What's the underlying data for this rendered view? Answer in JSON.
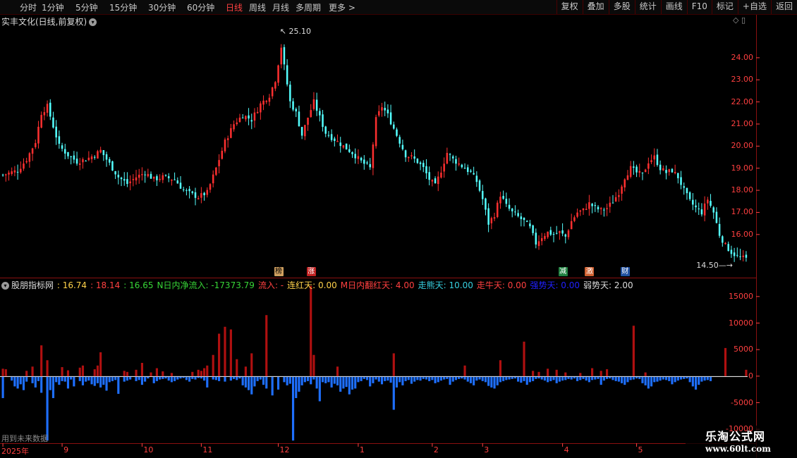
{
  "periods": [
    {
      "label": "分时"
    },
    {
      "label": "1分钟"
    },
    {
      "label": "5分钟"
    },
    {
      "label": "15分钟"
    },
    {
      "label": "30分钟"
    },
    {
      "label": "60分钟"
    },
    {
      "label": "日线",
      "active": true
    },
    {
      "label": "周线"
    },
    {
      "label": "月线"
    },
    {
      "label": "多周期"
    },
    {
      "label": "更多 >"
    }
  ],
  "tools": [
    "复权",
    "叠加",
    "多股",
    "统计",
    "画线",
    "F10",
    "标记",
    "+自选",
    "返回"
  ],
  "header": {
    "title": "实丰文化(日线,前复权)"
  },
  "top_icons": "◇ ▯",
  "indicator": {
    "name": "股朋指标网",
    "items": [
      {
        "text": ": 16.74",
        "color": "#ffd24a"
      },
      {
        "text": ": 18.14",
        "color": "#ff4040"
      },
      {
        "text": ": 16.65",
        "color": "#37d637"
      },
      {
        "text": "N日内净流入: -17373.79",
        "color": "#37d637"
      },
      {
        "text": "流入: -",
        "color": "#ff4040"
      },
      {
        "text": "连红天: 0.00",
        "color": "#ffd24a"
      },
      {
        "text": "M日内翻红天: 4.00",
        "color": "#ff4040"
      },
      {
        "text": "走熊天: 10.00",
        "color": "#37d0e0"
      },
      {
        "text": "走牛天: 0.00",
        "color": "#ff4040"
      },
      {
        "text": "强势天: 0.00",
        "color": "#2020ff"
      },
      {
        "text": "弱势天: 2.00",
        "color": "#dcdcdc"
      }
    ]
  },
  "future_note": "用到未来数据",
  "markers": [
    {
      "label": "榜",
      "day": 93,
      "color": "#d0a060",
      "text_color": "#000"
    },
    {
      "label": "涨",
      "day": 104,
      "color": "#c02020",
      "text_color": "#fff"
    },
    {
      "label": "减",
      "day": 189,
      "color": "#208040",
      "text_color": "#fff"
    },
    {
      "label": "激",
      "day": 198,
      "color": "#d06030",
      "text_color": "#fff"
    },
    {
      "label": "财",
      "day": 210,
      "color": "#2050a0",
      "text_color": "#fff"
    }
  ],
  "annotations": {
    "high": "25.10",
    "low": "14.50"
  },
  "watermark": {
    "line1": "乐淘公式网",
    "line2": "www.60lt.com"
  },
  "chart_data": {
    "type": "candlestick",
    "days": 252,
    "price_axis": {
      "ticks": [
        16,
        17,
        18,
        19,
        20,
        21,
        22,
        23,
        24
      ],
      "labels": [
        "16.00",
        "17.00",
        "18.00",
        "19.00",
        "20.00",
        "21.00",
        "22.00",
        "23.00",
        "24.00"
      ],
      "min": 14.4,
      "max": 25.4
    },
    "flow_axis": {
      "ticks": [
        15000,
        10000,
        5000,
        0,
        -5000,
        -10000
      ],
      "labels": [
        "15000",
        "10000",
        "5000",
        "0",
        "-5000",
        "-10000"
      ],
      "min": -12500,
      "max": 17500
    },
    "date_labels": [
      {
        "text": "2025年",
        "day": 0
      },
      {
        "text": "9",
        "day": 20
      },
      {
        "text": "10",
        "day": 47
      },
      {
        "text": "11",
        "day": 67
      },
      {
        "text": "12",
        "day": 93
      },
      {
        "text": "1",
        "day": 120
      },
      {
        "text": "2",
        "day": 145
      },
      {
        "text": "3",
        "day": 162
      },
      {
        "text": "4",
        "day": 189
      },
      {
        "text": "5",
        "day": 214
      }
    ],
    "price_anchors": [
      [
        0,
        18.7
      ],
      [
        5,
        18.9
      ],
      [
        8,
        19.4
      ],
      [
        11,
        20.2
      ],
      [
        13,
        21.5
      ],
      [
        15,
        21.8
      ],
      [
        17,
        20.9
      ],
      [
        19,
        20.0
      ],
      [
        22,
        19.6
      ],
      [
        25,
        19.3
      ],
      [
        28,
        19.4
      ],
      [
        31,
        19.6
      ],
      [
        33,
        19.8
      ],
      [
        36,
        19.2
      ],
      [
        39,
        18.6
      ],
      [
        42,
        18.3
      ],
      [
        45,
        18.6
      ],
      [
        48,
        18.8
      ],
      [
        51,
        18.5
      ],
      [
        54,
        18.6
      ],
      [
        58,
        18.5
      ],
      [
        61,
        18.0
      ],
      [
        64,
        17.8
      ],
      [
        66,
        17.7
      ],
      [
        69,
        17.9
      ],
      [
        72,
        19.0
      ],
      [
        75,
        20.2
      ],
      [
        78,
        21.0
      ],
      [
        81,
        21.4
      ],
      [
        84,
        21.2
      ],
      [
        87,
        21.9
      ],
      [
        90,
        22.3
      ],
      [
        92,
        23.0
      ],
      [
        94,
        24.5
      ],
      [
        95,
        23.6
      ],
      [
        97,
        22.0
      ],
      [
        99,
        21.5
      ],
      [
        101,
        20.5
      ],
      [
        103,
        21.3
      ],
      [
        105,
        22.0
      ],
      [
        107,
        21.3
      ],
      [
        109,
        20.6
      ],
      [
        112,
        20.3
      ],
      [
        115,
        20.0
      ],
      [
        118,
        19.7
      ],
      [
        121,
        19.3
      ],
      [
        124,
        19.0
      ],
      [
        126,
        21.2
      ],
      [
        128,
        21.8
      ],
      [
        130,
        21.4
      ],
      [
        132,
        20.8
      ],
      [
        134,
        20.2
      ],
      [
        136,
        19.6
      ],
      [
        138,
        19.5
      ],
      [
        140,
        19.3
      ],
      [
        142,
        19.0
      ],
      [
        144,
        18.5
      ],
      [
        146,
        18.2
      ],
      [
        148,
        18.9
      ],
      [
        150,
        19.7
      ],
      [
        152,
        19.4
      ],
      [
        154,
        19.2
      ],
      [
        156,
        19.0
      ],
      [
        158,
        18.8
      ],
      [
        160,
        18.4
      ],
      [
        162,
        17.6
      ],
      [
        164,
        16.5
      ],
      [
        166,
        16.9
      ],
      [
        168,
        17.8
      ],
      [
        170,
        17.3
      ],
      [
        172,
        17.0
      ],
      [
        174,
        16.8
      ],
      [
        176,
        16.6
      ],
      [
        178,
        16.3
      ],
      [
        180,
        15.6
      ],
      [
        182,
        15.9
      ],
      [
        184,
        16.1
      ],
      [
        186,
        16.0
      ],
      [
        188,
        16.1
      ],
      [
        190,
        15.9
      ],
      [
        192,
        16.6
      ],
      [
        194,
        17.0
      ],
      [
        196,
        17.1
      ],
      [
        198,
        17.4
      ],
      [
        200,
        17.2
      ],
      [
        202,
        17.1
      ],
      [
        204,
        17.2
      ],
      [
        206,
        17.5
      ],
      [
        208,
        17.9
      ],
      [
        210,
        18.6
      ],
      [
        212,
        19.0
      ],
      [
        214,
        18.8
      ],
      [
        216,
        18.7
      ],
      [
        218,
        19.3
      ],
      [
        220,
        19.5
      ],
      [
        222,
        19.0
      ],
      [
        224,
        18.8
      ],
      [
        226,
        18.9
      ],
      [
        228,
        18.6
      ],
      [
        230,
        18.0
      ],
      [
        232,
        17.5
      ],
      [
        234,
        17.2
      ],
      [
        236,
        17.0
      ],
      [
        238,
        17.6
      ],
      [
        240,
        17.0
      ],
      [
        242,
        16.0
      ],
      [
        244,
        15.5
      ],
      [
        246,
        15.2
      ],
      [
        248,
        15.0
      ],
      [
        251,
        14.9
      ]
    ],
    "flow_values": [
      -4000,
      600,
      900,
      -700,
      -1800,
      -2200,
      -1400,
      -2500,
      -900,
      3000,
      -1200,
      -2000,
      -800,
      -3000,
      1500,
      -12000,
      -2500,
      -4000,
      -1000,
      -1500,
      -800,
      -900,
      -2200,
      -500,
      -1800,
      700,
      -800,
      -1600,
      -900,
      -700,
      -1400,
      -1700,
      -1200,
      -2000,
      -1500,
      -2600,
      -1000,
      -800,
      -600,
      -3200,
      1200,
      -900,
      -700,
      -500,
      1000,
      -800,
      -600,
      -1500,
      -900,
      -300,
      600,
      -1200,
      -800,
      -500,
      -400,
      -300,
      -700,
      -1000,
      -800,
      -500,
      -300,
      -200,
      -600,
      -900,
      -400,
      -500,
      -200,
      -300,
      -700,
      -2000,
      3500,
      -500,
      -600,
      -800,
      6000,
      -900,
      9500,
      -700,
      -400,
      -600,
      -300,
      -1600,
      -2000,
      -2500,
      -3300,
      -1800,
      -800,
      -500,
      -1500,
      -2200,
      1200,
      -3500,
      3000,
      -2400,
      1500,
      -1000,
      -1600,
      -1300,
      -12000,
      -4000,
      -2800,
      -1600,
      -1000,
      -800,
      -1400,
      -500,
      -2200,
      -4600,
      -1000,
      -1200,
      -1000,
      -2000,
      -1300,
      -1600,
      -2800,
      -2200,
      -1900,
      -3300,
      -2400,
      -2200,
      -1000,
      -800,
      -400,
      -600,
      -1800,
      -1200,
      -500,
      -900,
      -1400,
      -800,
      -700,
      -1100,
      -6200,
      -2000,
      -1000,
      -1600,
      -800,
      -600,
      -1300,
      -900,
      -600,
      -700,
      -400,
      -500,
      -800,
      -600,
      -1200,
      -1000,
      -700,
      -500,
      -400,
      -1500,
      -900,
      -600,
      -400,
      -300,
      -500,
      -900,
      -1200,
      -1600,
      -700,
      -500,
      -800,
      -1000,
      -1700,
      -2000,
      -2200,
      -1600,
      -1000,
      -800,
      -600,
      -500,
      -400,
      -300,
      -900,
      -1100,
      -800,
      -1500,
      -1000,
      -800,
      -400,
      -300,
      -500,
      -700,
      -1000,
      -800,
      -600,
      -1200,
      -900,
      -700,
      -600,
      -400,
      -500,
      -300,
      -800,
      -600,
      -400,
      -700,
      -1000,
      -600,
      -500,
      -400,
      -1500,
      -700,
      -400,
      -300,
      -600,
      -800,
      -900,
      -1200,
      -1500,
      -1000,
      -600,
      -500,
      -300,
      -400,
      -1200,
      -1600,
      -2200,
      -1800,
      -1000,
      -900,
      -700,
      -500,
      -600,
      -800,
      -1400,
      -1000,
      -700,
      -500,
      -400,
      -300,
      -1000,
      -1800,
      -2400,
      -1500,
      -900,
      -700,
      -600,
      -800
    ],
    "flow_positive": [
      1400,
      1300,
      0,
      0,
      0,
      0,
      0,
      0,
      1000,
      0,
      1800,
      0,
      0,
      5800,
      0,
      3000,
      0,
      0,
      0,
      0,
      1700,
      0,
      1100,
      0,
      0,
      0,
      1600,
      2000,
      0,
      0,
      0,
      1300,
      2000,
      4500,
      0,
      0,
      0,
      0,
      0,
      0,
      0,
      1000,
      800,
      0,
      0,
      1200,
      0,
      2500,
      0,
      0,
      700,
      0,
      1500,
      0,
      900,
      0,
      0,
      600,
      0,
      0,
      0,
      0,
      0,
      0,
      800,
      0,
      1200,
      1000,
      1500,
      2000,
      0,
      4000,
      0,
      8000,
      0,
      9300,
      0,
      8800,
      0,
      3200,
      0,
      0,
      1800,
      0,
      4300,
      0,
      0,
      0,
      0,
      11500,
      0,
      0,
      0,
      0,
      0,
      0,
      0,
      0,
      0,
      0,
      0,
      0,
      0,
      0,
      17000,
      4000,
      0,
      0,
      0,
      0,
      0,
      0,
      0,
      1800,
      0,
      0,
      0,
      0,
      0,
      0,
      0,
      0,
      0,
      0,
      0,
      0,
      0,
      0,
      0,
      0,
      0,
      0,
      4300,
      0,
      0,
      0,
      0,
      0,
      0,
      0,
      0,
      0,
      0,
      0,
      0,
      0,
      0,
      0,
      0,
      0,
      0,
      0,
      0,
      0,
      0,
      0,
      2000,
      0,
      0,
      0,
      0,
      0,
      0,
      0,
      0,
      0,
      0,
      0,
      3000,
      0,
      0,
      0,
      0,
      0,
      0,
      0,
      6500,
      0,
      0,
      1000,
      0,
      800,
      0,
      0,
      1400,
      0,
      0,
      1200,
      0,
      0,
      700,
      0,
      0,
      0,
      0,
      600,
      0,
      0,
      0,
      1500,
      0,
      0,
      1000,
      0,
      1300,
      0,
      0,
      0,
      0,
      0,
      0,
      0,
      0,
      9500,
      0,
      0,
      0,
      700,
      0,
      0,
      0,
      0,
      0,
      0,
      0,
      0,
      0,
      0,
      0,
      0,
      0,
      0,
      0,
      0,
      0,
      0,
      0,
      0,
      0,
      0,
      0,
      0,
      0,
      0,
      5300,
      0,
      0,
      0,
      0,
      0,
      0,
      1200,
      0,
      0,
      0,
      0
    ]
  }
}
